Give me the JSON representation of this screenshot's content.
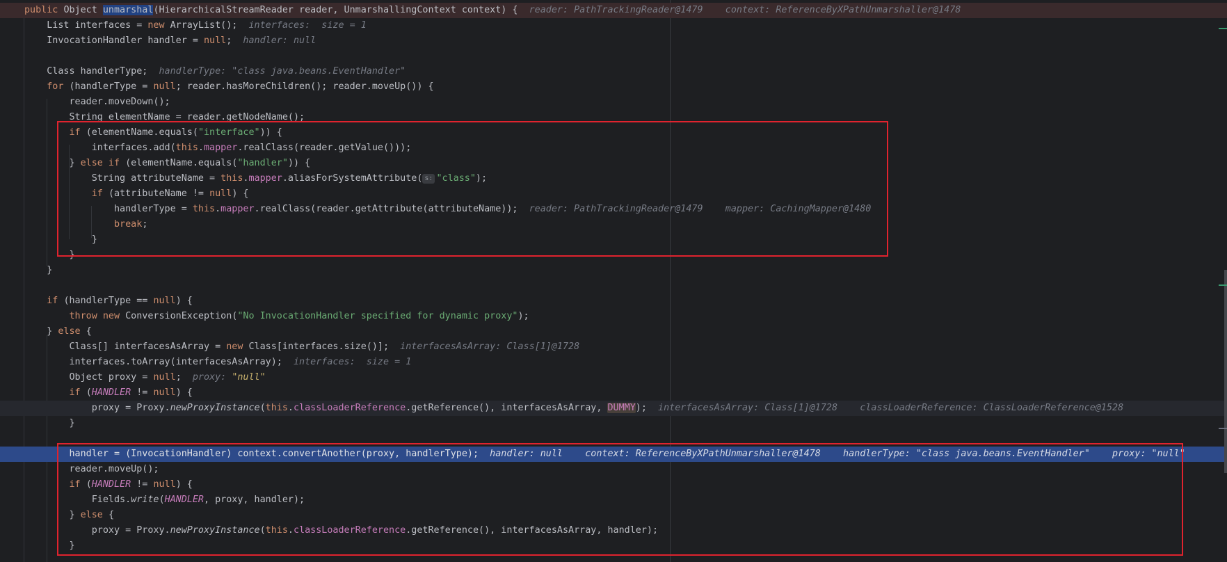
{
  "editor": {
    "lines": [
      {
        "cls": "first",
        "tokens": [
          {
            "t": "public ",
            "c": "kw"
          },
          {
            "t": "Object ",
            "c": ""
          },
          {
            "t": "unmarshal",
            "c": "hl-method"
          },
          {
            "t": "(HierarchicalStreamReader reader, UnmarshallingContext context) {",
            "c": ""
          },
          {
            "t": "  reader: PathTrackingReader@1479    context: ReferenceByXPathUnmarshaller@1478",
            "c": "hint"
          }
        ]
      },
      {
        "tokens": [
          {
            "t": "    List interfaces = ",
            "c": ""
          },
          {
            "t": "new ",
            "c": "kw"
          },
          {
            "t": "ArrayList();",
            "c": ""
          },
          {
            "t": "  interfaces:  size = 1",
            "c": "hint"
          }
        ]
      },
      {
        "tokens": [
          {
            "t": "    InvocationHandler handler = ",
            "c": ""
          },
          {
            "t": "null",
            "c": "kw"
          },
          {
            "t": ";",
            "c": ""
          },
          {
            "t": "  handler: null",
            "c": "hint"
          }
        ]
      },
      {
        "tokens": []
      },
      {
        "tokens": [
          {
            "t": "    Class handlerType;",
            "c": ""
          },
          {
            "t": "  handlerType: \"class java.beans.EventHandler\"",
            "c": "hint"
          }
        ]
      },
      {
        "tokens": [
          {
            "t": "    ",
            "c": ""
          },
          {
            "t": "for ",
            "c": "kw"
          },
          {
            "t": "(handlerType = ",
            "c": ""
          },
          {
            "t": "null",
            "c": "kw"
          },
          {
            "t": "; reader.hasMoreChildren(); reader.moveUp()) {",
            "c": ""
          }
        ]
      },
      {
        "tokens": [
          {
            "t": "        reader.moveDown();",
            "c": ""
          }
        ]
      },
      {
        "tokens": [
          {
            "t": "        String elementName = reader.getNodeName();",
            "c": ""
          }
        ]
      },
      {
        "tokens": [
          {
            "t": "        ",
            "c": ""
          },
          {
            "t": "if ",
            "c": "kw"
          },
          {
            "t": "(elementName.equals(",
            "c": ""
          },
          {
            "t": "\"interface\"",
            "c": "str"
          },
          {
            "t": ")) {",
            "c": ""
          }
        ]
      },
      {
        "tokens": [
          {
            "t": "            interfaces.add(",
            "c": ""
          },
          {
            "t": "this",
            "c": "kw"
          },
          {
            "t": ".",
            "c": ""
          },
          {
            "t": "mapper",
            "c": "fld"
          },
          {
            "t": ".realClass(reader.getValue()));",
            "c": ""
          }
        ]
      },
      {
        "tokens": [
          {
            "t": "        } ",
            "c": ""
          },
          {
            "t": "else if ",
            "c": "kw"
          },
          {
            "t": "(elementName.equals(",
            "c": ""
          },
          {
            "t": "\"handler\"",
            "c": "str"
          },
          {
            "t": ")) {",
            "c": ""
          }
        ]
      },
      {
        "tokens": [
          {
            "t": "            String attributeName = ",
            "c": ""
          },
          {
            "t": "this",
            "c": "kw"
          },
          {
            "t": ".",
            "c": ""
          },
          {
            "t": "mapper",
            "c": "fld"
          },
          {
            "t": ".aliasForSystemAttribute(",
            "c": ""
          },
          {
            "t": "s:",
            "c": "chip"
          },
          {
            "t": "\"class\"",
            "c": "str"
          },
          {
            "t": ");",
            "c": ""
          }
        ]
      },
      {
        "tokens": [
          {
            "t": "            ",
            "c": ""
          },
          {
            "t": "if ",
            "c": "kw"
          },
          {
            "t": "(attributeName != ",
            "c": ""
          },
          {
            "t": "null",
            "c": "kw"
          },
          {
            "t": ") {",
            "c": ""
          }
        ]
      },
      {
        "tokens": [
          {
            "t": "                handlerType = ",
            "c": ""
          },
          {
            "t": "this",
            "c": "kw"
          },
          {
            "t": ".",
            "c": ""
          },
          {
            "t": "mapper",
            "c": "fld"
          },
          {
            "t": ".realClass(reader.getAttribute(attributeName));",
            "c": ""
          },
          {
            "t": "  reader: PathTrackingReader@1479    mapper: CachingMapper@1480",
            "c": "hint"
          }
        ]
      },
      {
        "tokens": [
          {
            "t": "                ",
            "c": ""
          },
          {
            "t": "break",
            "c": "kw"
          },
          {
            "t": ";",
            "c": ""
          }
        ]
      },
      {
        "tokens": [
          {
            "t": "            }",
            "c": ""
          }
        ]
      },
      {
        "tokens": [
          {
            "t": "        }",
            "c": ""
          }
        ]
      },
      {
        "tokens": [
          {
            "t": "    }",
            "c": ""
          }
        ]
      },
      {
        "tokens": []
      },
      {
        "tokens": [
          {
            "t": "    ",
            "c": ""
          },
          {
            "t": "if ",
            "c": "kw"
          },
          {
            "t": "(handlerType == ",
            "c": ""
          },
          {
            "t": "null",
            "c": "kw"
          },
          {
            "t": ") {",
            "c": ""
          }
        ]
      },
      {
        "tokens": [
          {
            "t": "        ",
            "c": ""
          },
          {
            "t": "throw new ",
            "c": "kw"
          },
          {
            "t": "ConversionException(",
            "c": ""
          },
          {
            "t": "\"No InvocationHandler specified for dynamic proxy\"",
            "c": "str"
          },
          {
            "t": ");",
            "c": ""
          }
        ]
      },
      {
        "tokens": [
          {
            "t": "    } ",
            "c": ""
          },
          {
            "t": "else ",
            "c": "kw"
          },
          {
            "t": "{",
            "c": ""
          }
        ]
      },
      {
        "tokens": [
          {
            "t": "        Class[] interfacesAsArray = ",
            "c": ""
          },
          {
            "t": "new ",
            "c": "kw"
          },
          {
            "t": "Class[interfaces.size()];",
            "c": ""
          },
          {
            "t": "  interfacesAsArray: Class[1]@1728",
            "c": "hint"
          }
        ]
      },
      {
        "tokens": [
          {
            "t": "        interfaces.toArray(interfacesAsArray);",
            "c": ""
          },
          {
            "t": "  interfaces:  size = 1",
            "c": "hint"
          }
        ]
      },
      {
        "tokens": [
          {
            "t": "        Object proxy = ",
            "c": ""
          },
          {
            "t": "null",
            "c": "kw"
          },
          {
            "t": ";",
            "c": ""
          },
          {
            "t": "  proxy: ",
            "c": "hint"
          },
          {
            "t": "\"null\"",
            "c": "hint-str"
          }
        ]
      },
      {
        "tokens": [
          {
            "t": "        ",
            "c": ""
          },
          {
            "t": "if ",
            "c": "kw"
          },
          {
            "t": "(",
            "c": ""
          },
          {
            "t": "HANDLER",
            "c": "cst"
          },
          {
            "t": " != ",
            "c": ""
          },
          {
            "t": "null",
            "c": "kw"
          },
          {
            "t": ") {",
            "c": ""
          }
        ]
      },
      {
        "cls": "caret",
        "tokens": [
          {
            "t": "            proxy = Proxy.",
            "c": ""
          },
          {
            "t": "newProxyInstance",
            "c": "fn"
          },
          {
            "t": "(",
            "c": ""
          },
          {
            "t": "this",
            "c": "kw"
          },
          {
            "t": ".",
            "c": ""
          },
          {
            "t": "classLoaderReference",
            "c": "fld"
          },
          {
            "t": ".getReference(), interfacesAsArray, ",
            "c": ""
          },
          {
            "t": "DUMMY",
            "c": "dummy"
          },
          {
            "t": ");",
            "c": ""
          },
          {
            "t": "  interfacesAsArray: Class[1]@1728    classLoaderReference: ClassLoaderReference@1528",
            "c": "hint"
          }
        ]
      },
      {
        "tokens": [
          {
            "t": "        }",
            "c": ""
          }
        ]
      },
      {
        "tokens": []
      },
      {
        "cls": "exec",
        "tokens": [
          {
            "t": "        handler = (InvocationHandler) context.convertAnother(proxy, handlerType);",
            "c": ""
          },
          {
            "t": "  handler: null    context: ReferenceByXPathUnmarshaller@1478    handlerType: \"class java.beans.EventHandler\"    proxy: \"null\"",
            "c": "hint"
          }
        ]
      },
      {
        "tokens": [
          {
            "t": "        reader.moveUp();",
            "c": ""
          }
        ]
      },
      {
        "tokens": [
          {
            "t": "        ",
            "c": ""
          },
          {
            "t": "if ",
            "c": "kw"
          },
          {
            "t": "(",
            "c": ""
          },
          {
            "t": "HANDLER",
            "c": "cst"
          },
          {
            "t": " != ",
            "c": ""
          },
          {
            "t": "null",
            "c": "kw"
          },
          {
            "t": ") {",
            "c": ""
          }
        ]
      },
      {
        "tokens": [
          {
            "t": "            Fields.",
            "c": ""
          },
          {
            "t": "write",
            "c": "fn"
          },
          {
            "t": "(",
            "c": ""
          },
          {
            "t": "HANDLER",
            "c": "cst"
          },
          {
            "t": ", proxy, handler);",
            "c": ""
          }
        ]
      },
      {
        "tokens": [
          {
            "t": "        } ",
            "c": ""
          },
          {
            "t": "else ",
            "c": "kw"
          },
          {
            "t": "{",
            "c": ""
          }
        ]
      },
      {
        "tokens": [
          {
            "t": "            proxy = Proxy.",
            "c": ""
          },
          {
            "t": "newProxyInstance",
            "c": "fn"
          },
          {
            "t": "(",
            "c": ""
          },
          {
            "t": "this",
            "c": "kw"
          },
          {
            "t": ".",
            "c": ""
          },
          {
            "t": "classLoaderReference",
            "c": "fld"
          },
          {
            "t": ".getReference(), interfacesAsArray, handler);",
            "c": ""
          }
        ]
      },
      {
        "tokens": [
          {
            "t": "        }",
            "c": ""
          }
        ]
      }
    ]
  },
  "colors": {
    "background": "#1e1f22",
    "keyword": "#cf8e6d",
    "string": "#6aab73",
    "field": "#c77dbb",
    "hint": "#777b85",
    "execution_line": "#2d4a8a",
    "breakpoint_line": "#3a2a2c",
    "annotation_box": "#e0232e"
  }
}
